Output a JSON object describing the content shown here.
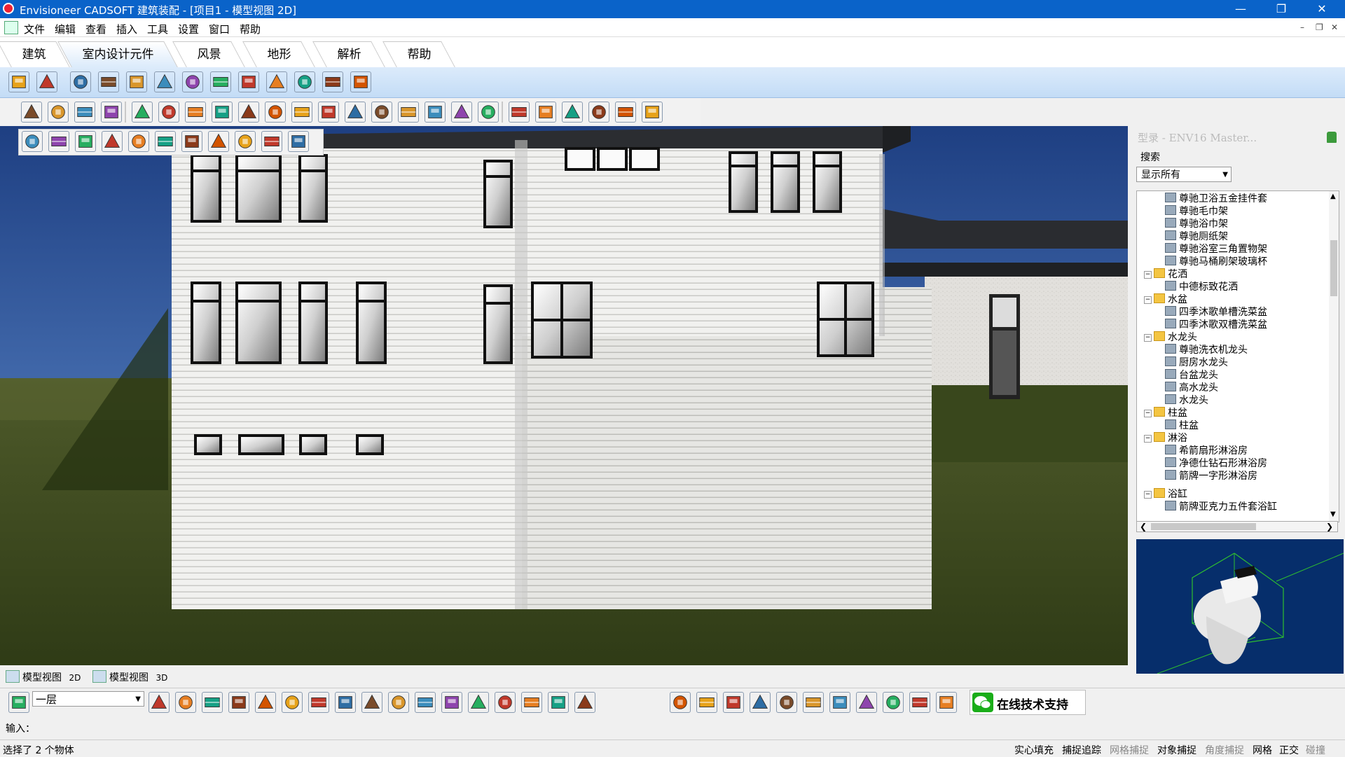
{
  "window": {
    "title": "Envisioneer CADSOFT 建筑装配 - [项目1 - 模型视图 2D]"
  },
  "menu": [
    "文件",
    "编辑",
    "查看",
    "插入",
    "工具",
    "设置",
    "窗口",
    "帮助"
  ],
  "tabs": [
    {
      "label": "建筑",
      "active": false
    },
    {
      "label": "室内设计元件",
      "active": true
    },
    {
      "label": "风景",
      "active": false
    },
    {
      "label": "地形",
      "active": false
    },
    {
      "label": "解析",
      "active": false
    },
    {
      "label": "帮助",
      "active": false
    }
  ],
  "library": {
    "header": "型录 - ENV16 Master...",
    "search_label": "搜索",
    "filter_value": "显示所有",
    "tree": [
      {
        "label": "尊驰卫浴五金挂件套",
        "level": 2
      },
      {
        "label": "尊驰毛巾架",
        "level": 2
      },
      {
        "label": "尊驰浴巾架",
        "level": 2
      },
      {
        "label": "尊驰厕纸架",
        "level": 2
      },
      {
        "label": "尊驰浴室三角置物架",
        "level": 2
      },
      {
        "label": "尊驰马桶刷架玻璃杯",
        "level": 2
      },
      {
        "label": "花洒",
        "level": 1
      },
      {
        "label": "中德标致花洒",
        "level": 2
      },
      {
        "label": "水盆",
        "level": 1
      },
      {
        "label": "四季沐歌单槽洗菜盆",
        "level": 2
      },
      {
        "label": "四季沐歌双槽洗菜盆",
        "level": 2
      },
      {
        "label": "水龙头",
        "level": 1
      },
      {
        "label": "尊驰洗衣机龙头",
        "level": 2
      },
      {
        "label": "厨房水龙头",
        "level": 2
      },
      {
        "label": "台盆龙头",
        "level": 2
      },
      {
        "label": "高水龙头",
        "level": 2
      },
      {
        "label": "水龙头",
        "level": 2
      },
      {
        "label": "柱盆",
        "level": 1
      },
      {
        "label": "柱盆",
        "level": 2
      },
      {
        "label": "淋浴",
        "level": 1
      },
      {
        "label": "希箭扇形淋浴房",
        "level": 2
      },
      {
        "label": "净德仕钻石形淋浴房",
        "level": 2
      },
      {
        "label": "箭牌一字形淋浴房",
        "level": 2
      },
      {
        "label": "浴缸",
        "level": 1
      },
      {
        "label": "箭牌亚克力五件套浴缸",
        "level": 2
      }
    ]
  },
  "view_tabs": [
    {
      "label": "模型视图",
      "suffix": "2D"
    },
    {
      "label": "模型视图",
      "suffix": "3D"
    }
  ],
  "floor_select": "一层",
  "support_label": "在线技术支持",
  "input_label": "输入：",
  "status": {
    "message": "选择了 2 个物体",
    "items": [
      {
        "label": "实心填充",
        "on": true
      },
      {
        "label": "捕捉追踪",
        "on": true
      },
      {
        "label": "网格捕捉",
        "on": false
      },
      {
        "label": "对象捕捉",
        "on": true
      },
      {
        "label": "角度捕捉",
        "on": false
      },
      {
        "label": "网格",
        "on": true
      },
      {
        "label": "正交",
        "on": true
      },
      {
        "label": "碰撞",
        "on": false
      }
    ]
  },
  "icons": {
    "ribbon1": [
      "select-arrow-icon",
      "paint-brush-icon",
      "cabinet-icon",
      "table-icon",
      "appliance-icon",
      "tv-icon",
      "sofa-icon",
      "bathtub-icon",
      "bed-icon",
      "lamp-icon",
      "plant-icon",
      "fireplace-icon",
      "faucet-icon"
    ],
    "ribbon2": [
      "text-style-icon",
      "dimension-icon",
      "annotation-icon",
      "label-icon",
      "text-icon",
      "text-edit-icon",
      "text-box-icon",
      "dim-vertical-icon",
      "dim-cross-icon",
      "dim-horizontal-icon",
      "dim-angle-icon",
      "dim-corner-icon",
      "grid-dim-icon",
      "grid-dim-2-icon",
      "grid-dim-3-icon",
      "scale-1x2-icon",
      "annotation-2-icon",
      "label-2-icon",
      "list-icon",
      "settings-icon",
      "roof-icon",
      "layout-icon",
      "chart-icon",
      "layers-icon"
    ],
    "ribbon3": [
      "new-file-icon",
      "open-folder-icon",
      "open-project-icon",
      "folder-icon",
      "save-icon",
      "save-all-icon",
      "panel-icon",
      "undo-icon",
      "redo-icon",
      "print-icon",
      "help-icon"
    ],
    "bottom": [
      "floor-icon",
      "view-2d-icon",
      "view-2d-plus-icon",
      "view-3d-icon",
      "camera-icon",
      "layout-icon",
      "presentation-icon",
      "house-icon",
      "house-2-icon",
      "roof-view-icon",
      "photo-icon",
      "walkthrough-icon",
      "fence-icon",
      "box-icon",
      "monitor-icon",
      "monitor-2-icon",
      "house-3-icon",
      "robot-icon",
      "zoom-in-icon",
      "zoom-out-icon",
      "zoom-window-icon",
      "zoom-extents-icon",
      "zoom-search-icon",
      "zoom-fit-icon",
      "pan-hand-icon",
      "walk-icon",
      "orbit-icon",
      "lock-icon",
      "camera-2-icon"
    ]
  }
}
